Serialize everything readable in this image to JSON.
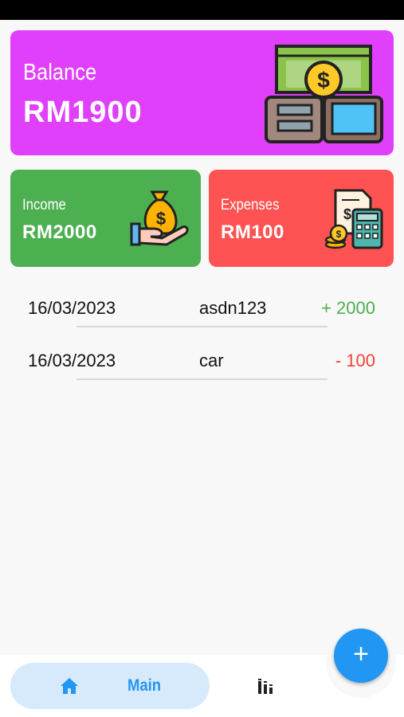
{
  "colors": {
    "balance_card": "#e040fb",
    "income_card": "#4caf50",
    "expense_card": "#ff5252",
    "accent": "#2196f3",
    "income_text": "#4caf50",
    "expense_text": "#f44336"
  },
  "balance": {
    "label": "Balance",
    "value": "RM1900",
    "icon": "money-wallet-icon"
  },
  "income": {
    "label": "Income",
    "value": "RM2000",
    "icon": "money-bag-hand-icon"
  },
  "expenses": {
    "label": "Expenses",
    "value": "RM100",
    "icon": "bill-calculator-icon"
  },
  "transactions": [
    {
      "date": "16/03/2023",
      "name": "asdn123",
      "amount": "+ 2000",
      "type": "income"
    },
    {
      "date": "16/03/2023",
      "name": "car",
      "amount": "- 100",
      "type": "expense"
    }
  ],
  "nav": {
    "home_label": "Main",
    "home_icon": "home-icon",
    "stats_icon": "bar-chart-icon"
  },
  "fab": {
    "label": "+",
    "icon": "plus-icon"
  }
}
